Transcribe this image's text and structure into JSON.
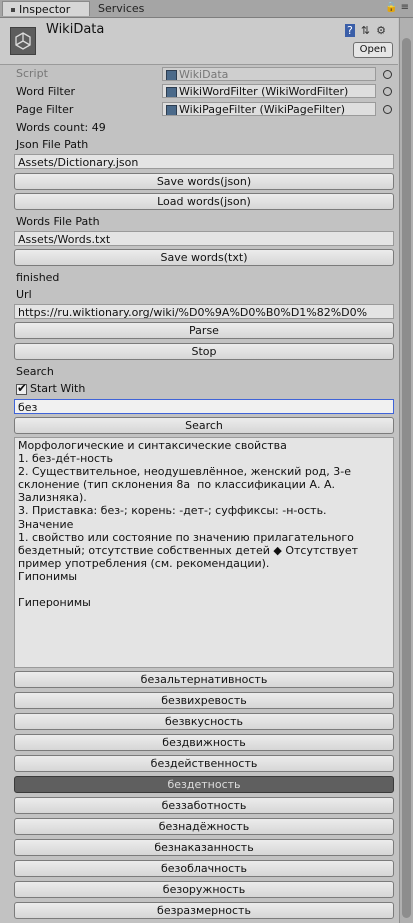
{
  "tabs": [
    {
      "label": "Inspector"
    },
    {
      "label": "Services"
    }
  ],
  "header": {
    "title": "WikiData",
    "open_label": "Open"
  },
  "fields": {
    "script_label": "Script",
    "script_value": "WikiData",
    "word_filter_label": "Word Filter",
    "word_filter_value": "WikiWordFilter (WikiWordFilter)",
    "page_filter_label": "Page Filter",
    "page_filter_value": "WikiPageFilter (WikiPageFilter)",
    "words_count": "Words count: 49",
    "json_path_label": "Json File Path",
    "json_path_value": "Assets/Dictionary.json",
    "save_json_label": "Save words(json)",
    "load_json_label": "Load words(json)",
    "words_path_label": "Words File Path",
    "words_path_value": "Assets/Words.txt",
    "save_txt_label": "Save words(txt)",
    "status": "finished",
    "url_label": "Url",
    "url_value": "https://ru.wiktionary.org/wiki/%D0%9A%D0%B0%D1%82%D0%",
    "parse_label": "Parse",
    "stop_label": "Stop",
    "search_label": "Search",
    "start_with_label": "Start With",
    "search_value": "без",
    "search_button_label": "Search"
  },
  "result_text": "Морфологические и синтаксические свойства\n1. без-де́т-ность\n2. Существительное, неодушевлённое, женский род, 3-е склонение (тип склонения 8a  по классификации А. А. Зализняка).\n3. Приставка: без-; корень: -дет-; суффиксы: -н-ость.\nЗначение\n1. свойство или состояние по значению прилагательного бездетный; отсутствие собственных детей ◆ Отсутствует пример употребления (см. рекомендации).\nГипонимы\n\nГиперонимы",
  "words": [
    {
      "label": "безальтернативность",
      "selected": false
    },
    {
      "label": "безвихревость",
      "selected": false
    },
    {
      "label": "безвкусность",
      "selected": false
    },
    {
      "label": "бездвижность",
      "selected": false
    },
    {
      "label": "бездейственность",
      "selected": false
    },
    {
      "label": "бездетность",
      "selected": true
    },
    {
      "label": "беззаботность",
      "selected": false
    },
    {
      "label": "безнадёжность",
      "selected": false
    },
    {
      "label": "безнаказанность",
      "selected": false
    },
    {
      "label": "безоблачность",
      "selected": false
    },
    {
      "label": "безоружность",
      "selected": false
    },
    {
      "label": "безразмерность",
      "selected": false
    }
  ]
}
